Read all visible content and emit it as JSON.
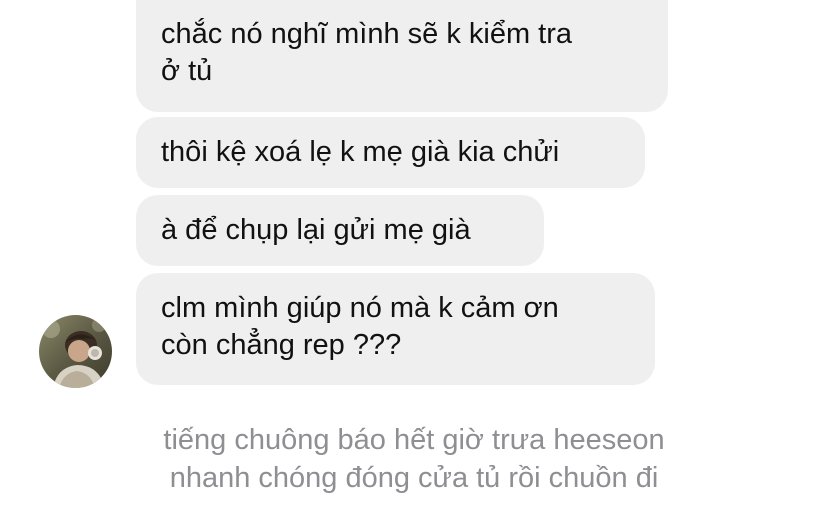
{
  "messages": [
    {
      "lines": [
        "chắc nó nghĩ mình sẽ k kiểm tra",
        "ở tủ"
      ]
    },
    {
      "lines": [
        "thôi kệ xoá lẹ k mẹ già kia chửi"
      ]
    },
    {
      "lines": [
        "à để chụp lại gửi mẹ già"
      ]
    },
    {
      "lines": [
        "clm mình giúp nó mà k cảm ơn",
        "còn chẳng rep ???"
      ]
    }
  ],
  "narration": {
    "lines": [
      "tiếng chuông báo hết giờ trưa heeseon",
      "nhanh chóng đóng cửa tủ rồi chuồn đi"
    ]
  },
  "colors": {
    "bubble_bg": "#efeff0",
    "message_text": "#111111",
    "narration_text": "#8e8e93"
  }
}
